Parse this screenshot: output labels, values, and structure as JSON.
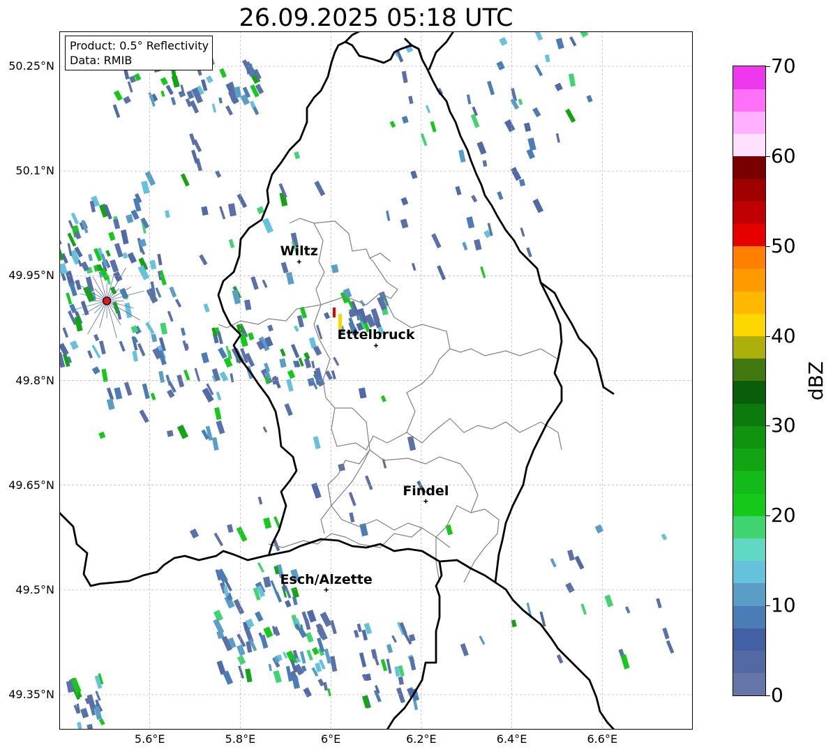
{
  "title": "26.09.2025 05:18 UTC",
  "info": {
    "product": "Product: 0.5° Reflectivity",
    "source": "Data: RMIB"
  },
  "extent": {
    "lon_min": 5.4,
    "lon_max": 6.8,
    "lat_min": 49.3,
    "lat_max": 50.3
  },
  "lat_ticks": [
    {
      "value": 50.25,
      "label": "50.25°N"
    },
    {
      "value": 50.1,
      "label": "50.1°N"
    },
    {
      "value": 49.95,
      "label": "49.95°N"
    },
    {
      "value": 49.8,
      "label": "49.8°N"
    },
    {
      "value": 49.65,
      "label": "49.65°N"
    },
    {
      "value": 49.5,
      "label": "49.5°N"
    },
    {
      "value": 49.35,
      "label": "49.35°N"
    }
  ],
  "lon_ticks": [
    {
      "value": 5.6,
      "label": "5.6°E"
    },
    {
      "value": 5.8,
      "label": "5.8°E"
    },
    {
      "value": 6.0,
      "label": "6°E"
    },
    {
      "value": 6.2,
      "label": "6.2°E"
    },
    {
      "value": 6.4,
      "label": "6.4°E"
    },
    {
      "value": 6.6,
      "label": "6.6°E"
    }
  ],
  "cities": [
    {
      "name": "Wiltz",
      "lon": 5.93,
      "lat": 49.97
    },
    {
      "name": "Ettelbruck",
      "lon": 6.1,
      "lat": 49.85
    },
    {
      "name": "Findel",
      "lon": 6.21,
      "lat": 49.627
    },
    {
      "name": "Esch/Alzette",
      "lon": 5.99,
      "lat": 49.5
    }
  ],
  "radar_site": {
    "lon": 5.505,
    "lat": 49.914,
    "color": "#e8141e"
  },
  "colorbar": {
    "unit": "dBZ",
    "min": 0,
    "max": 70,
    "ticks": [
      0,
      10,
      20,
      30,
      40,
      50,
      60,
      70
    ],
    "colors": [
      "#6477a8",
      "#5369a3",
      "#4260a3",
      "#4a7cb5",
      "#5a9ec8",
      "#66c2dc",
      "#60d8c4",
      "#40d470",
      "#15c81a",
      "#14b91a",
      "#13a414",
      "#109410",
      "#0c7a0c",
      "#0a5e0a",
      "#437810",
      "#adb00a",
      "#ffd700",
      "#ffb800",
      "#ff9a00",
      "#ff8000",
      "#e60000",
      "#c00000",
      "#a00000",
      "#780000",
      "#ffe0ff",
      "#ffb0ff",
      "#ff70f8",
      "#ee38ee"
    ]
  },
  "colors": {
    "border": "#000000",
    "canton": "#808080",
    "grid": "#b0b0b0"
  }
}
